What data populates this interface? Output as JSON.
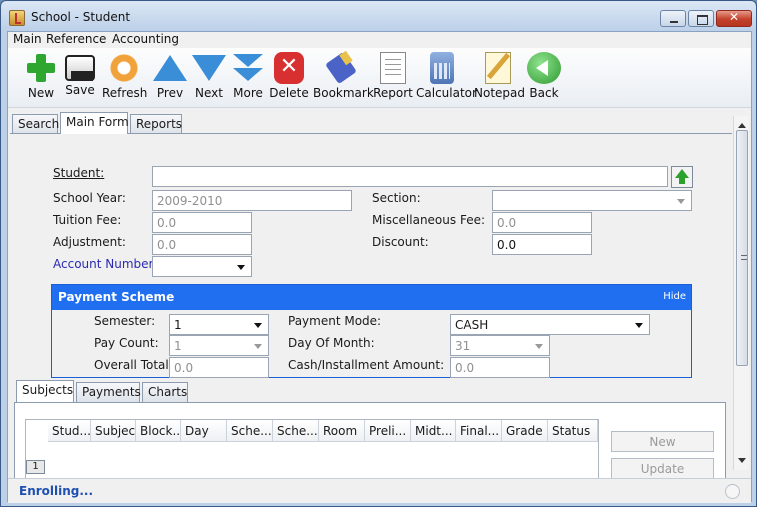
{
  "window": {
    "title": "School -  Student"
  },
  "menu": [
    "Main",
    "Reference",
    "Accounting"
  ],
  "toolbar": [
    {
      "label": "New",
      "icon": "plus-icon"
    },
    {
      "label": "Save",
      "icon": "save-icon"
    },
    {
      "label": "Refresh",
      "icon": "refresh-icon"
    },
    {
      "label": "Prev",
      "icon": "up-arrow-icon"
    },
    {
      "label": "Next",
      "icon": "down-arrow-icon"
    },
    {
      "label": "More",
      "icon": "double-down-arrow-icon"
    },
    {
      "label": "Delete",
      "icon": "delete-icon"
    },
    {
      "label": "Bookmark",
      "icon": "bookmark-icon"
    },
    {
      "label": "Report",
      "icon": "report-icon"
    },
    {
      "label": "Calculator",
      "icon": "calculator-icon"
    },
    {
      "label": "Notepad",
      "icon": "notepad-icon"
    },
    {
      "label": "Back",
      "icon": "back-icon"
    }
  ],
  "tabs": [
    "Search",
    "Main Form",
    "Reports"
  ],
  "active_tab": "Main Form",
  "form": {
    "student_label": "Student:",
    "student_value": "",
    "school_year_label": "School Year:",
    "school_year_value": "2009-2010",
    "section_label": "Section:",
    "section_value": "",
    "tuition_label": "Tuition Fee:",
    "tuition_value": "0.0",
    "misc_label": "Miscellaneous Fee:",
    "misc_value": "0.0",
    "adjustment_label": "Adjustment:",
    "adjustment_value": "0.0",
    "discount_label": "Discount:",
    "discount_value": "0.0",
    "account_label": "Account Number:",
    "account_value": ""
  },
  "payment_scheme": {
    "title": "Payment Scheme",
    "hide": "Hide",
    "semester_label": "Semester:",
    "semester_value": "1",
    "pay_count_label": "Pay Count:",
    "pay_count_value": "1",
    "overall_total_label": "Overall Total:",
    "overall_total_value": "0.0",
    "payment_mode_label": "Payment Mode:",
    "payment_mode_value": "CASH",
    "day_of_month_label": "Day Of Month:",
    "day_of_month_value": "31",
    "installment_label": "Cash/Installment Amount:",
    "installment_value": "0.0"
  },
  "subtabs": [
    "Subjects",
    "Payments",
    "Charts"
  ],
  "active_subtab": "Subjects",
  "grid": {
    "columns": [
      "Stud...",
      "Subject",
      "Block...",
      "Day",
      "Sche...",
      "Sche...",
      "Room",
      "Preli...",
      "Midt...",
      "Final...",
      "Grade",
      "Status"
    ],
    "row_button": "1"
  },
  "side_buttons": {
    "new": "New",
    "update": "Update"
  },
  "status": {
    "text": "Enrolling..."
  }
}
